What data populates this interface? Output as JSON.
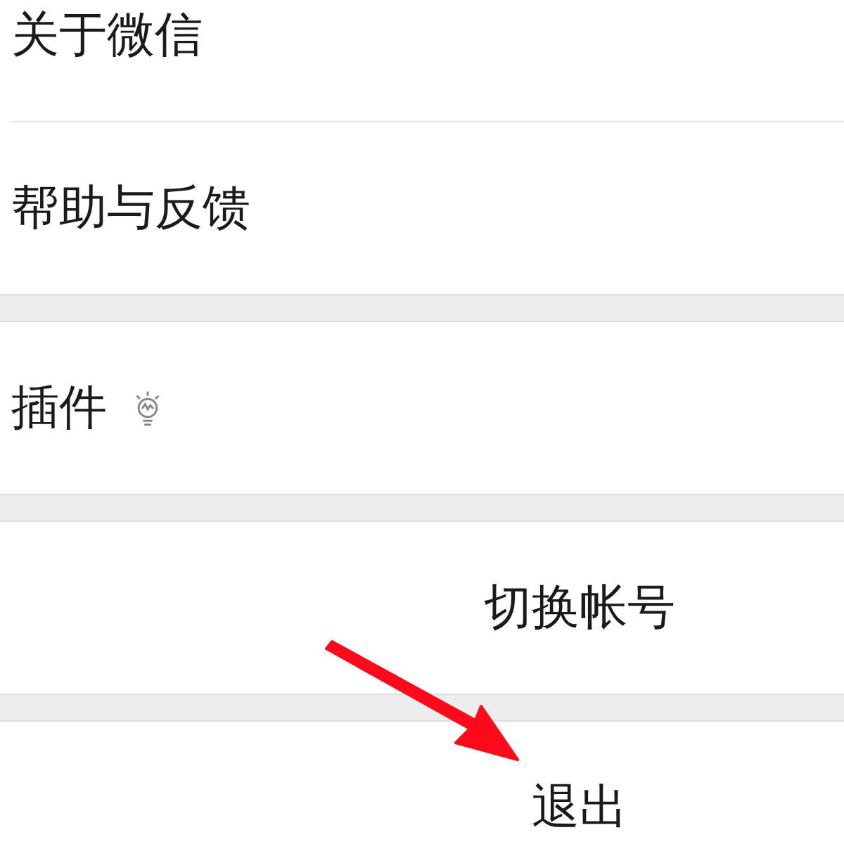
{
  "groups": [
    {
      "items": [
        {
          "label": "关于微信",
          "kind": "nav"
        },
        {
          "label": "帮助与反馈",
          "kind": "nav"
        }
      ]
    },
    {
      "items": [
        {
          "label": "插件",
          "kind": "tip"
        }
      ]
    },
    {
      "items": [
        {
          "label": "切换帐号",
          "kind": "action"
        }
      ]
    },
    {
      "items": [
        {
          "label": "退出",
          "kind": "action"
        }
      ]
    }
  ]
}
